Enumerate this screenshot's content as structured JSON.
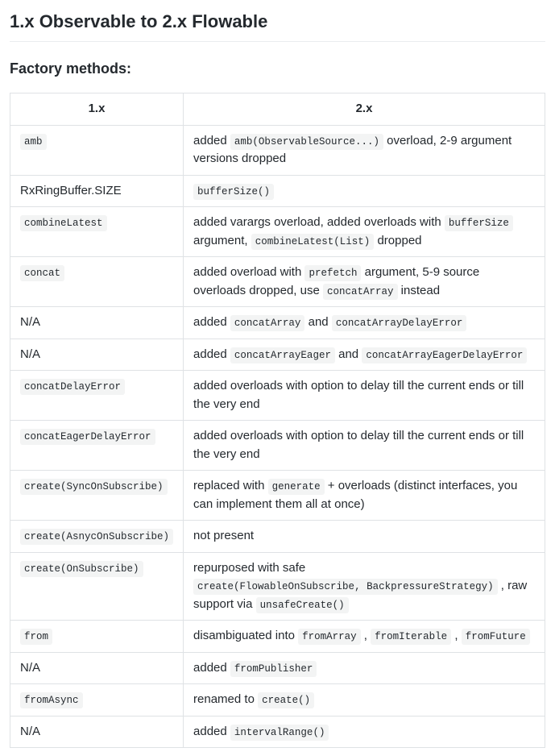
{
  "heading": "1.x Observable to 2.x Flowable",
  "subheading": "Factory methods:",
  "table": {
    "headers": {
      "col1": "1.x",
      "col2": "2.x"
    },
    "rows": [
      {
        "col1": [
          {
            "t": "code",
            "v": "amb"
          }
        ],
        "col2": [
          {
            "t": "text",
            "v": "added "
          },
          {
            "t": "code",
            "v": "amb(ObservableSource...)"
          },
          {
            "t": "text",
            "v": " overload, 2-9 argument versions dropped"
          }
        ]
      },
      {
        "col1": [
          {
            "t": "text",
            "v": "RxRingBuffer.SIZE"
          }
        ],
        "col2": [
          {
            "t": "code",
            "v": "bufferSize()"
          }
        ]
      },
      {
        "col1": [
          {
            "t": "code",
            "v": "combineLatest"
          }
        ],
        "col2": [
          {
            "t": "text",
            "v": "added varargs overload, added overloads with "
          },
          {
            "t": "code",
            "v": "bufferSize"
          },
          {
            "t": "text",
            "v": " argument, "
          },
          {
            "t": "code",
            "v": "combineLatest(List)"
          },
          {
            "t": "text",
            "v": " dropped"
          }
        ]
      },
      {
        "col1": [
          {
            "t": "code",
            "v": "concat"
          }
        ],
        "col2": [
          {
            "t": "text",
            "v": "added overload with "
          },
          {
            "t": "code",
            "v": "prefetch"
          },
          {
            "t": "text",
            "v": " argument, 5-9 source overloads dropped, use "
          },
          {
            "t": "code",
            "v": "concatArray"
          },
          {
            "t": "text",
            "v": " instead"
          }
        ]
      },
      {
        "col1": [
          {
            "t": "text",
            "v": "N/A"
          }
        ],
        "col2": [
          {
            "t": "text",
            "v": "added "
          },
          {
            "t": "code",
            "v": "concatArray"
          },
          {
            "t": "text",
            "v": " and "
          },
          {
            "t": "code",
            "v": "concatArrayDelayError"
          }
        ]
      },
      {
        "col1": [
          {
            "t": "text",
            "v": "N/A"
          }
        ],
        "col2": [
          {
            "t": "text",
            "v": "added "
          },
          {
            "t": "code",
            "v": "concatArrayEager"
          },
          {
            "t": "text",
            "v": " and "
          },
          {
            "t": "code",
            "v": "concatArrayEagerDelayError"
          }
        ]
      },
      {
        "col1": [
          {
            "t": "code",
            "v": "concatDelayError"
          }
        ],
        "col2": [
          {
            "t": "text",
            "v": "added overloads with option to delay till the current ends or till the very end"
          }
        ]
      },
      {
        "col1": [
          {
            "t": "code",
            "v": "concatEagerDelayError"
          }
        ],
        "col2": [
          {
            "t": "text",
            "v": "added overloads with option to delay till the current ends or till the very end"
          }
        ]
      },
      {
        "col1": [
          {
            "t": "code",
            "v": "create(SyncOnSubscribe)"
          }
        ],
        "col2": [
          {
            "t": "text",
            "v": "replaced with "
          },
          {
            "t": "code",
            "v": "generate"
          },
          {
            "t": "text",
            "v": " + overloads (distinct interfaces, you can implement them all at once)"
          }
        ]
      },
      {
        "col1": [
          {
            "t": "code",
            "v": "create(AsnycOnSubscribe)"
          }
        ],
        "col2": [
          {
            "t": "text",
            "v": "not present"
          }
        ]
      },
      {
        "col1": [
          {
            "t": "code",
            "v": "create(OnSubscribe)"
          }
        ],
        "col2": [
          {
            "t": "text",
            "v": "repurposed with safe "
          },
          {
            "t": "code",
            "v": "create(FlowableOnSubscribe, BackpressureStrategy)"
          },
          {
            "t": "text",
            "v": " , raw support via "
          },
          {
            "t": "code",
            "v": "unsafeCreate()"
          }
        ]
      },
      {
        "col1": [
          {
            "t": "code",
            "v": "from"
          }
        ],
        "col2": [
          {
            "t": "text",
            "v": "disambiguated into "
          },
          {
            "t": "code",
            "v": "fromArray"
          },
          {
            "t": "text",
            "v": " , "
          },
          {
            "t": "code",
            "v": "fromIterable"
          },
          {
            "t": "text",
            "v": " , "
          },
          {
            "t": "code",
            "v": "fromFuture"
          }
        ]
      },
      {
        "col1": [
          {
            "t": "text",
            "v": "N/A"
          }
        ],
        "col2": [
          {
            "t": "text",
            "v": "added "
          },
          {
            "t": "code",
            "v": "fromPublisher"
          }
        ]
      },
      {
        "col1": [
          {
            "t": "code",
            "v": "fromAsync"
          }
        ],
        "col2": [
          {
            "t": "text",
            "v": "renamed to "
          },
          {
            "t": "code",
            "v": "create()"
          }
        ]
      },
      {
        "col1": [
          {
            "t": "text",
            "v": "N/A"
          }
        ],
        "col2": [
          {
            "t": "text",
            "v": "added "
          },
          {
            "t": "code",
            "v": "intervalRange()"
          }
        ]
      }
    ]
  }
}
